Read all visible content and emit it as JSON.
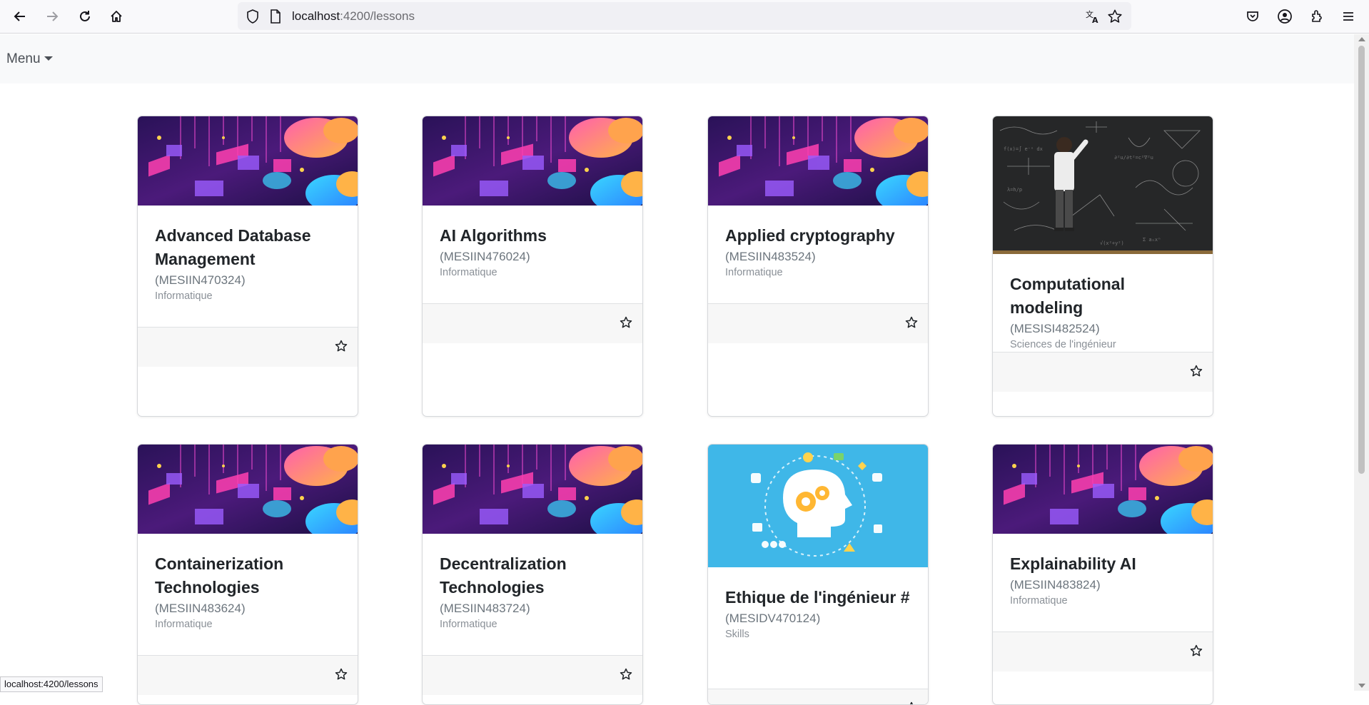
{
  "browser": {
    "url_host": "localhost",
    "url_path": ":4200/lessons",
    "status_url": "localhost:4200/lessons"
  },
  "navbar": {
    "menu_label": "Menu"
  },
  "image_styles": {
    "tech": "tech-isometric-illustration",
    "board": "chalkboard-photo",
    "brain": "head-gears-illustration"
  },
  "cards": [
    {
      "title": "Advanced Database Management",
      "code": "(MESIIN470324)",
      "category": "Informatique",
      "image": "tech"
    },
    {
      "title": "AI Algorithms",
      "code": "(MESIIN476024)",
      "category": "Informatique",
      "image": "tech"
    },
    {
      "title": "Applied cryptography",
      "code": "(MESIIN483524)",
      "category": "Informatique",
      "image": "tech"
    },
    {
      "title": "Computational modeling",
      "code": "(MESISI482524)",
      "category": "Sciences de l'ingénieur",
      "image": "board"
    },
    {
      "title": "Containerization Technologies",
      "code": "(MESIIN483624)",
      "category": "Informatique",
      "image": "tech"
    },
    {
      "title": "Decentralization Technologies",
      "code": "(MESIIN483724)",
      "category": "Informatique",
      "image": "tech"
    },
    {
      "title": "Ethique de l'ingénieur #",
      "code": "(MESIDV470124)",
      "category": "Skills",
      "image": "brain"
    },
    {
      "title": "Explainability AI",
      "code": "(MESIIN483824)",
      "category": "Informatique",
      "image": "tech"
    }
  ]
}
